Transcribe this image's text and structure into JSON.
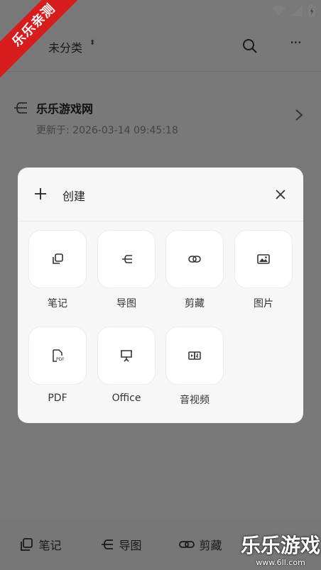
{
  "header": {
    "category_label": "未分类",
    "category_arrow": "⬍",
    "more_label": "···"
  },
  "list": {
    "items": [
      {
        "title": "乐乐游戏网",
        "updated": "更新于: 2026-03-14 09:45:18"
      }
    ]
  },
  "bottom_tabs": [
    {
      "label": "笔记",
      "icon": "note-icon"
    },
    {
      "label": "导图",
      "icon": "mindmap-icon"
    },
    {
      "label": "剪藏",
      "icon": "link-icon"
    }
  ],
  "modal": {
    "title": "创建",
    "tiles": [
      {
        "label": "笔记",
        "icon": "note-icon"
      },
      {
        "label": "导图",
        "icon": "mindmap-icon"
      },
      {
        "label": "剪藏",
        "icon": "link-icon"
      },
      {
        "label": "图片",
        "icon": "image-icon"
      },
      {
        "label": "PDF",
        "icon": "pdf-icon"
      },
      {
        "label": "Office",
        "icon": "presentation-icon"
      },
      {
        "label": "音视频",
        "icon": "media-icon"
      }
    ]
  },
  "watermark": {
    "ribbon": "乐乐亲测",
    "brand": "乐乐游戏",
    "url": "www.6ll.com"
  },
  "colors": {
    "ribbon": "#d61c1c",
    "overlay": "rgba(0,0,0,0.50)",
    "modal_bg": "#f7f7f7"
  }
}
